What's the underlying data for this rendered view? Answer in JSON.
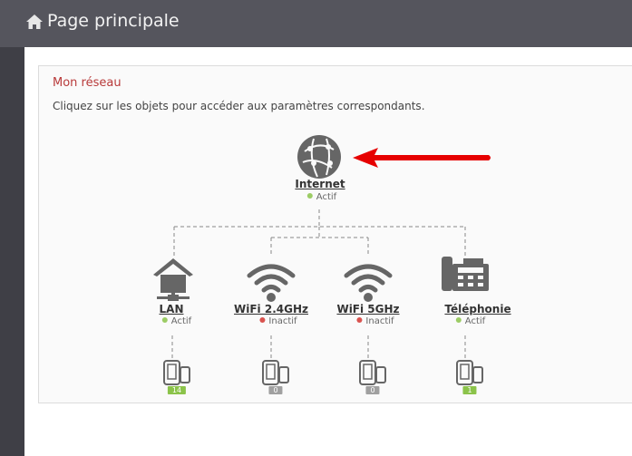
{
  "header": {
    "title": "Page principale",
    "icon": "home-icon"
  },
  "section": {
    "title": "Mon réseau",
    "instructions": "Cliquez sur les objets pour accéder aux paramètres correspondants."
  },
  "colors": {
    "active": "#9ccc65",
    "inactive": "#d9534f",
    "badge_active": "#8bc34a",
    "badge_inactive": "#a0a0a0",
    "icon": "#666666",
    "arrow": "#e60000"
  },
  "internet": {
    "label": "Internet",
    "status": "Actif",
    "state": "active",
    "icon": "globe-icon"
  },
  "nodes": [
    {
      "label": "LAN",
      "status": "Actif",
      "state": "active",
      "icon": "house-network-icon",
      "devices": "14"
    },
    {
      "label": "WiFi 2.4GHz",
      "status": "Inactif",
      "state": "inactive",
      "icon": "wifi-icon",
      "devices": "0"
    },
    {
      "label": "WiFi 5GHz",
      "status": "Inactif",
      "state": "inactive",
      "icon": "wifi-icon",
      "devices": "0"
    },
    {
      "label": "Téléphonie",
      "status": "Actif",
      "state": "active",
      "icon": "phone-icon",
      "devices": "1"
    }
  ]
}
